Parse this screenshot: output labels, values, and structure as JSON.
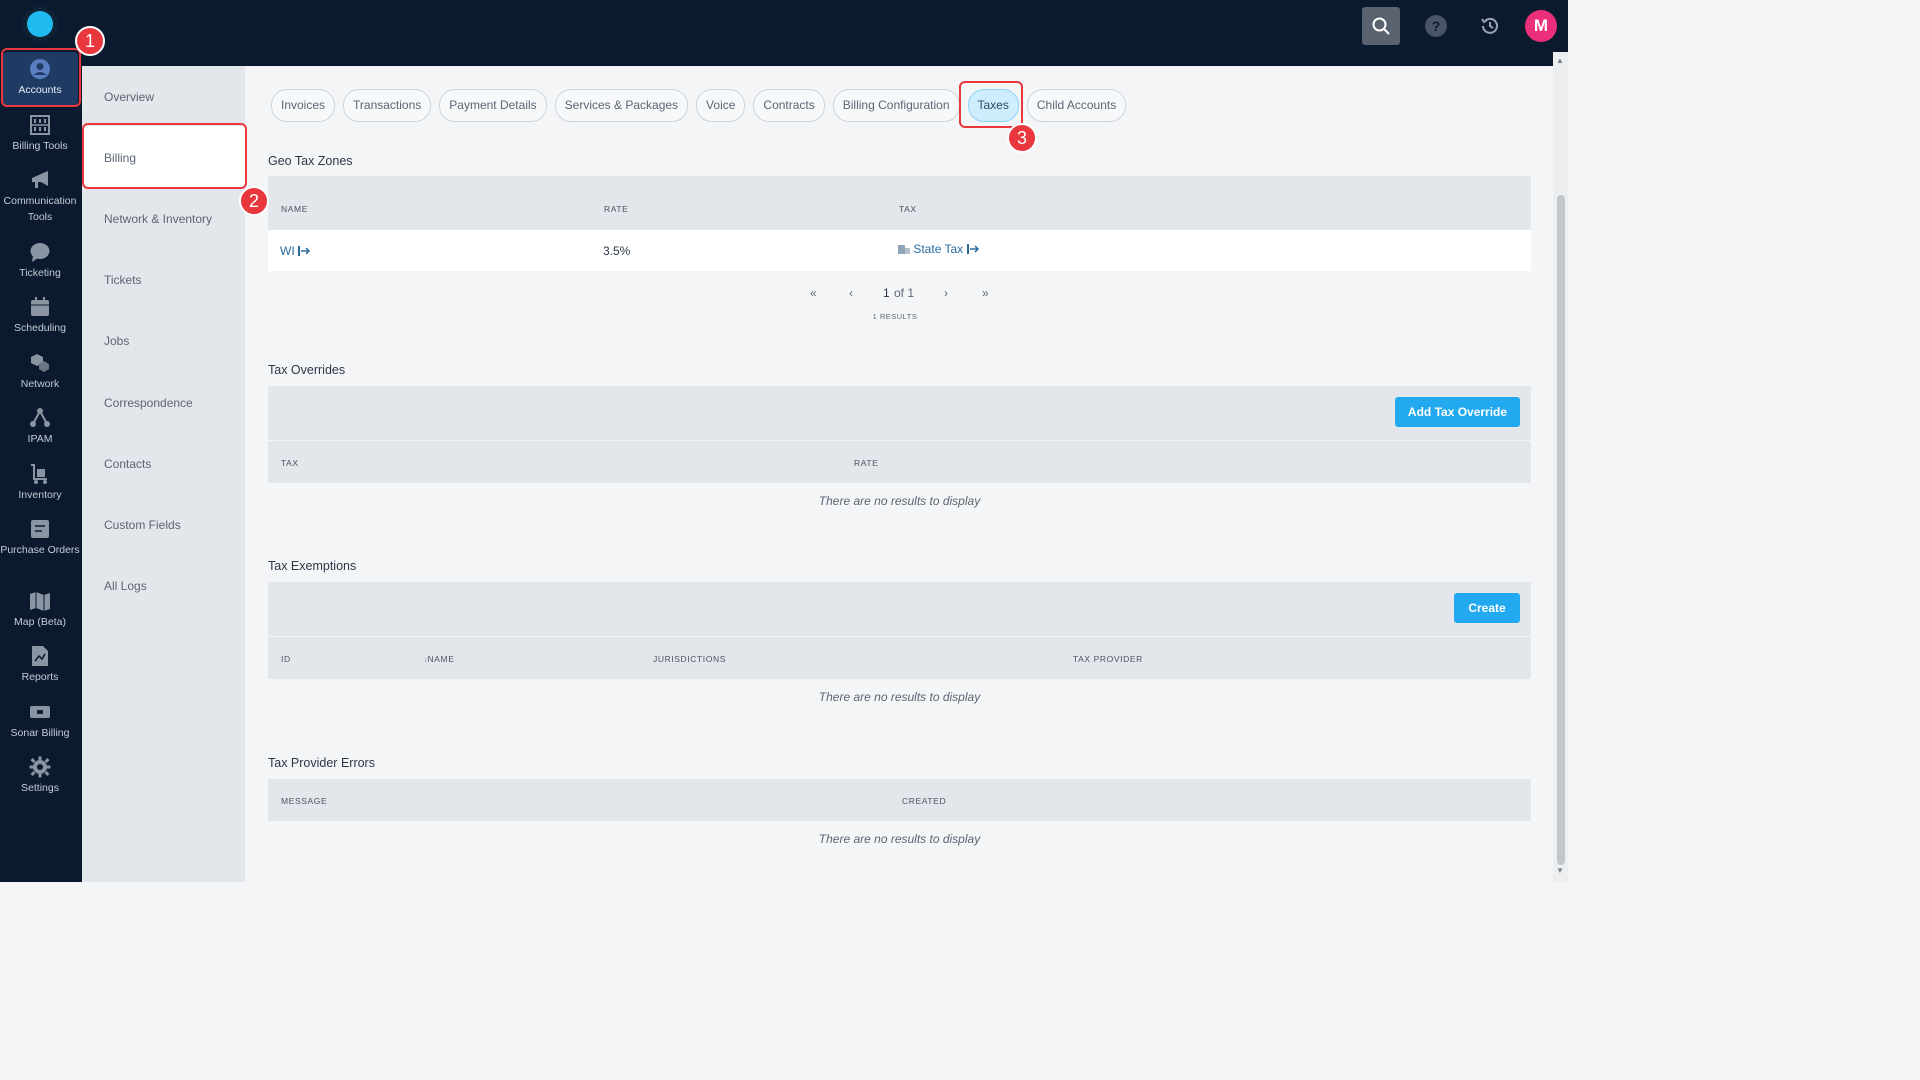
{
  "header": {
    "avatar_initial": "M",
    "help_label": "?"
  },
  "rail": {
    "items": [
      {
        "label": "Accounts",
        "icon": "user-icon"
      },
      {
        "label": "Billing Tools",
        "icon": "abacus-icon"
      },
      {
        "label": "Communication Tools",
        "icon": "megaphone-icon"
      },
      {
        "label": "Ticketing",
        "icon": "chat-icon"
      },
      {
        "label": "Scheduling",
        "icon": "calendar-icon"
      },
      {
        "label": "Network",
        "icon": "network-icon"
      },
      {
        "label": "IPAM",
        "icon": "ipam-icon"
      },
      {
        "label": "Inventory",
        "icon": "cart-icon"
      },
      {
        "label": "Purchase Orders",
        "icon": "order-icon"
      },
      {
        "label": "Map (Beta)",
        "icon": "map-icon"
      },
      {
        "label": "Reports",
        "icon": "report-icon"
      },
      {
        "label": "Sonar Billing",
        "icon": "billing-icon"
      },
      {
        "label": "Settings",
        "icon": "gear-icon"
      }
    ]
  },
  "subnav": {
    "items": [
      "Overview",
      "Billing",
      "Network & Inventory",
      "Tickets",
      "Jobs",
      "Correspondence",
      "Contacts",
      "Custom Fields",
      "All Logs"
    ]
  },
  "tabs": [
    "Invoices",
    "Transactions",
    "Payment Details",
    "Services & Packages",
    "Voice",
    "Contracts",
    "Billing Configuration",
    "Taxes",
    "Child Accounts"
  ],
  "geo_tax_zones": {
    "title": "Geo Tax Zones",
    "columns": [
      "NAME",
      "RATE",
      "TAX"
    ],
    "rows": [
      {
        "name": "WI",
        "rate": "3.5%",
        "tax": "State Tax"
      }
    ],
    "pager": {
      "first": "«",
      "prev": "‹",
      "page": "1",
      "of": "of 1",
      "next": "›",
      "last": "»"
    },
    "results": "1 RESULTS"
  },
  "tax_overrides": {
    "title": "Tax Overrides",
    "button": "Add Tax Override",
    "columns": [
      "TAX",
      "RATE"
    ],
    "empty": "There are no results to display"
  },
  "tax_exemptions": {
    "title": "Tax Exemptions",
    "button": "Create",
    "columns": [
      "ID",
      "NAME",
      "JURISDICTIONS",
      "TAX PROVIDER"
    ],
    "empty": "There are no results to display"
  },
  "tax_provider_errors": {
    "title": "Tax Provider Errors",
    "columns": [
      "MESSAGE",
      "CREATED"
    ],
    "empty": "There are no results to display"
  },
  "annotations": [
    "1",
    "2",
    "3"
  ]
}
